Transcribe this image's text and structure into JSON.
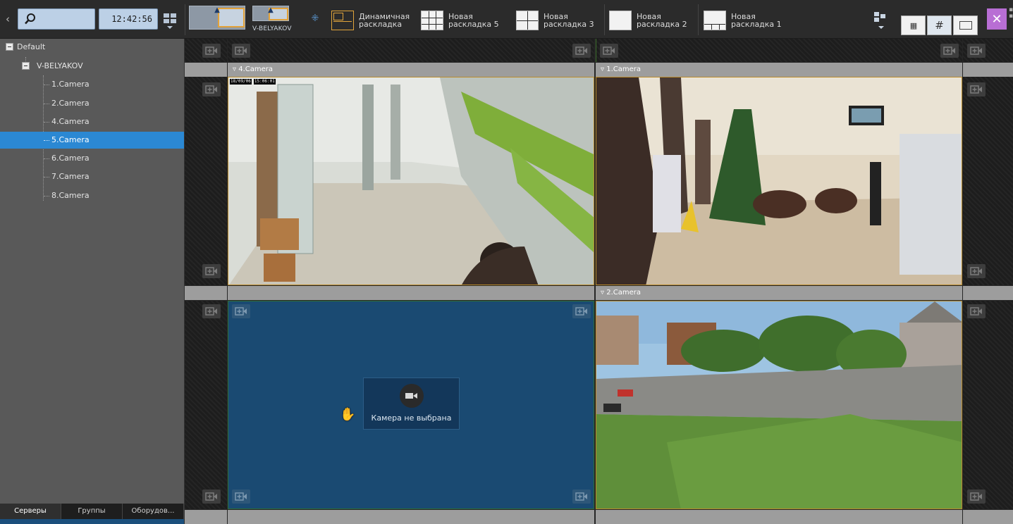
{
  "toolbar": {
    "clock": "12:42:56",
    "thumb_active_label": "V-BELYAKOV",
    "layouts": [
      {
        "line1": "Динамичная",
        "line2": "раскладка"
      },
      {
        "line1": "Новая",
        "line2": "раскладка 5"
      },
      {
        "line1": "Новая",
        "line2": "раскладка 3"
      },
      {
        "line1": "Новая",
        "line2": "раскладка 2"
      },
      {
        "line1": "Новая",
        "line2": "раскладка 1"
      }
    ],
    "accent_color": "#b86ed4"
  },
  "sidebar": {
    "root": "Default",
    "server": "V-BELYAKOV",
    "cameras": [
      "1.Camera",
      "2.Camera",
      "4.Camera",
      "5.Camera",
      "6.Camera",
      "7.Camera",
      "8.Camera"
    ],
    "selected_camera": "5.Camera",
    "selected_color": "#2b88d3",
    "tabs": [
      "Серверы",
      "Группы",
      "Оборудов..."
    ]
  },
  "grid": {
    "cells": {
      "top_left": {
        "title": "4.Camera",
        "osd_date": "18/09/06",
        "osd_time": "15:06:01"
      },
      "top_right": {
        "title": "1.Camera"
      },
      "bottom_right": {
        "title": "2.Camera"
      },
      "bottom_left": {
        "empty_text": "Камера не выбрана"
      }
    }
  }
}
